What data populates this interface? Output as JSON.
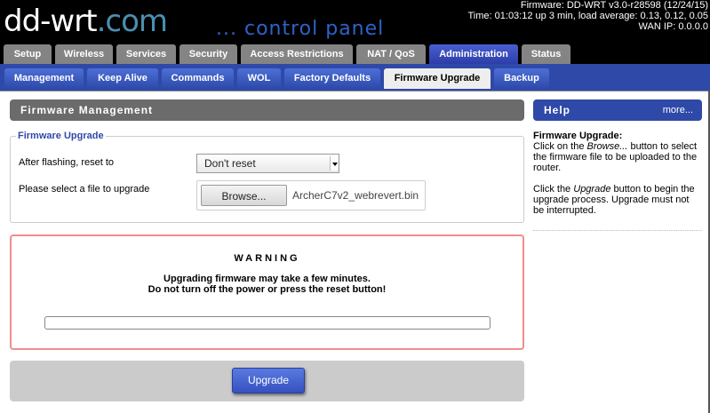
{
  "header": {
    "logo_dd": "dd-wrt",
    "logo_com": ".com",
    "tagline": "... control panel",
    "firmware": "Firmware: DD-WRT v3.0-r28598 (12/24/15)",
    "uptime": "Time: 01:03:12 up 3 min, load average: 0.13, 0.12, 0.05",
    "wan_ip": "WAN IP: 0.0.0.0"
  },
  "main_tabs": [
    {
      "label": "Setup"
    },
    {
      "label": "Wireless"
    },
    {
      "label": "Services"
    },
    {
      "label": "Security"
    },
    {
      "label": "Access Restrictions"
    },
    {
      "label": "NAT / QoS"
    },
    {
      "label": "Administration",
      "active": true
    },
    {
      "label": "Status"
    }
  ],
  "sub_tabs": [
    {
      "label": "Management"
    },
    {
      "label": "Keep Alive"
    },
    {
      "label": "Commands"
    },
    {
      "label": "WOL"
    },
    {
      "label": "Factory Defaults"
    },
    {
      "label": "Firmware Upgrade",
      "active": true
    },
    {
      "label": "Backup"
    }
  ],
  "firmware_management": {
    "title": "Firmware Management",
    "fieldset_legend": "Firmware Upgrade",
    "reset_label": "After flashing, reset to",
    "reset_value": "Don't reset",
    "file_label": "Please select a file to upgrade",
    "browse_label": "Browse...",
    "file_name": "ArcherC7v2_webrevert.bin"
  },
  "warning": {
    "title": "WARNING",
    "line1": "Upgrading firmware may take a few minutes.",
    "line2": "Do not turn off the power or press the reset button!",
    "progress": 0
  },
  "actions": {
    "upgrade_label": "Upgrade"
  },
  "help": {
    "title": "Help",
    "more": "more...",
    "heading": "Firmware Upgrade:",
    "p1_a": "Click on the ",
    "p1_em": "Browse...",
    "p1_b": " button to select the firmware file to be uploaded to the router.",
    "p2_a": "Click the ",
    "p2_em": "Upgrade",
    "p2_b": " button to begin the upgrade process. Upgrade must not be interrupted."
  },
  "colors": {
    "accent": "#2f49a8",
    "warning_border": "#ef8e8e",
    "section_gray": "#6b6b6b"
  }
}
